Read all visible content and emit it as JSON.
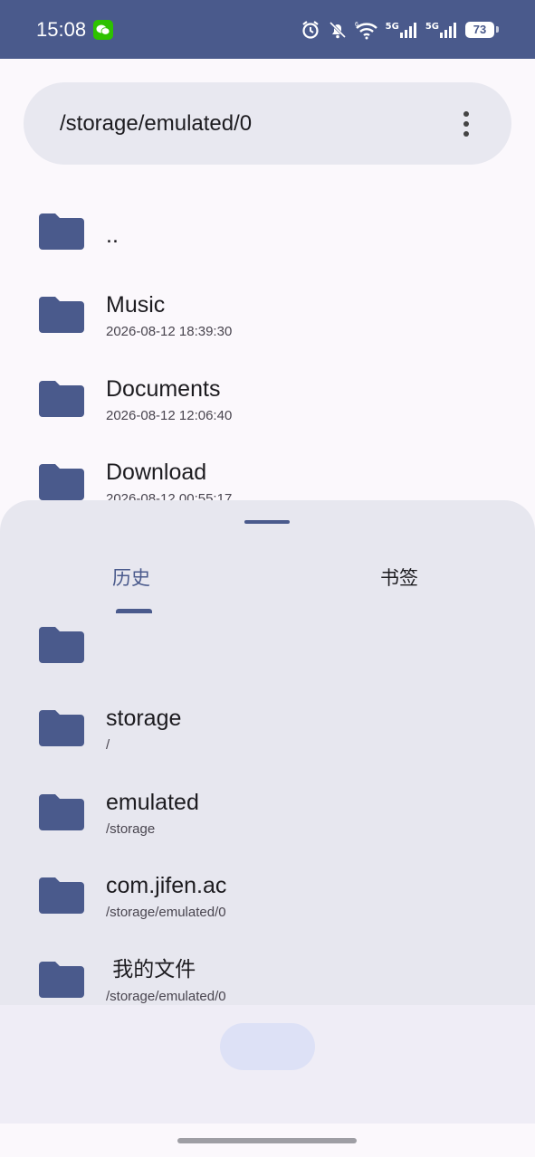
{
  "status_bar": {
    "time": "15:08",
    "network_1": "5G",
    "network_2": "5G",
    "battery": "73"
  },
  "path_bar": {
    "path": "/storage/emulated/0"
  },
  "file_list": [
    {
      "name": "..",
      "sub": ""
    },
    {
      "name": "Music",
      "sub": "2026-08-12 18:39:30"
    },
    {
      "name": "Documents",
      "sub": "2026-08-12 12:06:40"
    },
    {
      "name": "Download",
      "sub": "2026-08-12 00:55:17"
    }
  ],
  "sheet": {
    "tabs": [
      {
        "label": "历史",
        "selected": true
      },
      {
        "label": "书签",
        "selected": false
      }
    ],
    "history": [
      {
        "name": "",
        "sub": ""
      },
      {
        "name": "storage",
        "sub": "/"
      },
      {
        "name": "emulated",
        "sub": "/storage"
      },
      {
        "name": "com.jifen.ac",
        "sub": "/storage/emulated/0"
      },
      {
        "name": " 我的文件",
        "sub": "/storage/emulated/0"
      }
    ]
  },
  "colors": {
    "accent": "#4a5a8c",
    "folder": "#4a5a8c",
    "sheet_bg": "#e7e7ef"
  }
}
